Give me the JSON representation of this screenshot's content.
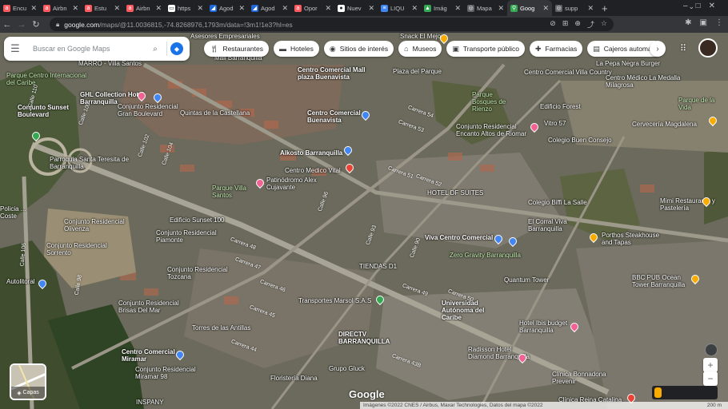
{
  "tabs": [
    {
      "label": "Encu",
      "icon": "airbnb-icon",
      "color": "#ff5a5f"
    },
    {
      "label": "Airbn",
      "icon": "airbnb-icon",
      "color": "#ff5a5f"
    },
    {
      "label": "Estu",
      "icon": "airbnb-icon",
      "color": "#ff5a5f"
    },
    {
      "label": "Airbn",
      "icon": "airbnb-icon",
      "color": "#ff5a5f"
    },
    {
      "label": "https",
      "icon": "page-icon",
      "color": "#ffffff"
    },
    {
      "label": "Agod",
      "icon": "agoda-icon",
      "color": "#2067da"
    },
    {
      "label": "Agod",
      "icon": "agoda-icon",
      "color": "#2067da"
    },
    {
      "label": "Opor",
      "icon": "airbnb-icon",
      "color": "#ff5a5f"
    },
    {
      "label": "Nuev",
      "icon": "github-icon",
      "color": "#ffffff"
    },
    {
      "label": "LIQU",
      "icon": "docs-icon",
      "color": "#4285f4"
    },
    {
      "label": "Imág",
      "icon": "image-icon",
      "color": "#34a853"
    },
    {
      "label": "Mapa",
      "icon": "globe-icon",
      "color": "#bdc1c6"
    },
    {
      "label": "Goog",
      "icon": "maps-icon",
      "color": "#34a853"
    },
    {
      "label": "supp",
      "icon": "globe-icon",
      "color": "#bdc1c6"
    }
  ],
  "active_tab_index": 12,
  "address_bar": {
    "host": "google.com",
    "path": "/maps/@11.0036815,-74.8268976,1793m/data=!3m1!1e3?hl=es"
  },
  "search": {
    "placeholder": "Buscar en Google Maps"
  },
  "chips": [
    {
      "label": "Restaurantes",
      "icon": "fork-knife-icon"
    },
    {
      "label": "Hoteles",
      "icon": "bed-icon"
    },
    {
      "label": "Sitios de interés",
      "icon": "camera-icon"
    },
    {
      "label": "Museos",
      "icon": "museum-icon"
    },
    {
      "label": "Transporte público",
      "icon": "bus-icon"
    },
    {
      "label": "Farmacias",
      "icon": "pharmacy-icon"
    },
    {
      "label": "Cajeros automátic",
      "icon": "atm-icon"
    }
  ],
  "map_labels": [
    {
      "text": "Asesores Empresariales",
      "bold": false
    },
    {
      "text": "Snack El Mejor",
      "bold": false
    },
    {
      "text": "Parque Centro Internacional del Caribe",
      "bold": false
    },
    {
      "text": "MARRO - Villa Santos",
      "bold": false
    },
    {
      "text": "Mall Barranquilla",
      "bold": false
    },
    {
      "text": "Centro Comercial Mall plaza Buenavista",
      "bold": true
    },
    {
      "text": "Plaza del Parque",
      "bold": false
    },
    {
      "text": "La Pepa Negra Burger",
      "bold": false
    },
    {
      "text": "Centro Comercial Villa Country",
      "bold": false
    },
    {
      "text": "Centro Médico La Medalla Milagrosa",
      "bold": false
    },
    {
      "text": "GHL Collection Hotel Barranquilla",
      "bold": true
    },
    {
      "text": "Conjunto Sunset Boulevard",
      "bold": true
    },
    {
      "text": "Conjunto Residencial Gran Boulevard",
      "bold": false
    },
    {
      "text": "Quintas de la Castellana",
      "bold": false
    },
    {
      "text": "Centro Comercial Buenavista",
      "bold": true
    },
    {
      "text": "Parque Bosques de Rienzo",
      "bold": false
    },
    {
      "text": "Edificio Forest",
      "bold": false
    },
    {
      "text": "Parque de la Vida",
      "bold": false
    },
    {
      "text": "Conjunto Residencial Encanto Altos de Riomar",
      "bold": false
    },
    {
      "text": "Vitro 57",
      "bold": false
    },
    {
      "text": "Cervecería Magdalena",
      "bold": false
    },
    {
      "text": "Colegio Buen Consejo",
      "bold": false
    },
    {
      "text": "Alkosto Barranquilla",
      "bold": true
    },
    {
      "text": "Parroquia Santa Teresita de Barranquilla",
      "bold": false
    },
    {
      "text": "Centro Medico Vital",
      "bold": false
    },
    {
      "text": "Parque Villa Santos",
      "bold": false
    },
    {
      "text": "Patinódromo Alex Cujavante",
      "bold": false
    },
    {
      "text": "HOTEL DF SUITES",
      "bold": false
    },
    {
      "text": "Colegio Biffi La Salle",
      "bold": false
    },
    {
      "text": "Policia ... Coste",
      "bold": false
    },
    {
      "text": "Conjunto Residencial Olivenza",
      "bold": false
    },
    {
      "text": "Edificio Sunset 100",
      "bold": false
    },
    {
      "text": "El Corral Viva Barranquilla",
      "bold": false
    },
    {
      "text": "Mimi Restaurante y Pastelería",
      "bold": false
    },
    {
      "text": "Conjunto Residencial Piamonte",
      "bold": false
    },
    {
      "text": "Viva Centro Comercial",
      "bold": true
    },
    {
      "text": "Porthos Steakhouse and Tapas",
      "bold": false
    },
    {
      "text": "Conjunto Residencial Sorrento",
      "bold": false
    },
    {
      "text": "Zero Gravity Barranquilla",
      "bold": false
    },
    {
      "text": "Conjunto Residencial Tozcana",
      "bold": false
    },
    {
      "text": "TIENDAS D1",
      "bold": false
    },
    {
      "text": "Quantum Tower",
      "bold": false
    },
    {
      "text": "BBC PUB Ocean Tower Barranquilla",
      "bold": false
    },
    {
      "text": "Autolitoral",
      "bold": false
    },
    {
      "text": "Transportes Marsol S.A.S",
      "bold": false
    },
    {
      "text": "Conjunto Residencial Brisas Del Mar",
      "bold": false
    },
    {
      "text": "Universidad Autónoma del Caribe",
      "bold": true
    },
    {
      "text": "Torres de las Antillas",
      "bold": false
    },
    {
      "text": "Hotel Ibis budget Barranquilla",
      "bold": false
    },
    {
      "text": "DIRECTV BARRANQUILLA",
      "bold": true
    },
    {
      "text": "Centro Comercial Miramar",
      "bold": true
    },
    {
      "text": "Radisson Hotel Diamond Barranquilla",
      "bold": false
    },
    {
      "text": "Conjunto Residencial Miramar 98",
      "bold": false
    },
    {
      "text": "Grupo Gluck",
      "bold": false
    },
    {
      "text": "Floristería Diana",
      "bold": false
    },
    {
      "text": "Clínica Bonnadona Prevenir",
      "bold": false
    },
    {
      "text": "Clínica Reina Catalina",
      "bold": false
    },
    {
      "text": "INSPANY",
      "bold": false
    }
  ],
  "road_labels": [
    "Carrera 54",
    "Carrera 53",
    "Carrera 52",
    "Carrera 51",
    "Carrera 50",
    "Carrera 49",
    "Carrera 48",
    "Carrera 47",
    "Carrera 46",
    "Carrera 45",
    "Carrera 44",
    "Carrera 43B",
    "Calle 98",
    "Calle 100",
    "Calle 102",
    "Calle 104",
    "Calle 106",
    "Calle 110",
    "Calle 96",
    "Calle 93",
    "Calle 90"
  ],
  "layers_button": {
    "label": "Capas"
  },
  "brand": {
    "label": "Google"
  },
  "footer": {
    "attribution": "Imágenes ©2022 CNES / Airbus, Maxar Technologies, Datos del mapa ©2022",
    "scale": "200 m"
  },
  "colors": {
    "chip_bg": "#ffffff",
    "directions": "#1a73e8",
    "dark_chrome": "#202124"
  }
}
